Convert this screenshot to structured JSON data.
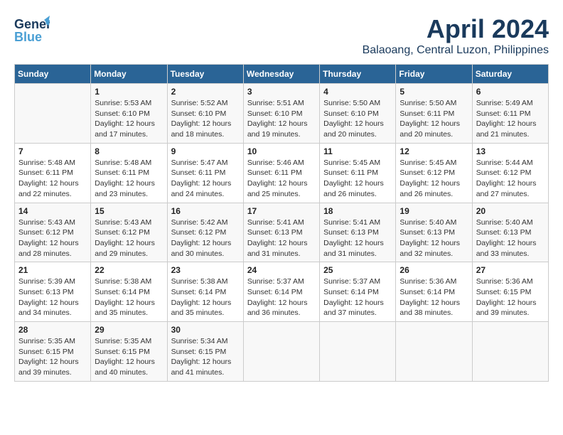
{
  "header": {
    "logo_line1": "General",
    "logo_line2": "Blue",
    "month": "April 2024",
    "location": "Balaoang, Central Luzon, Philippines"
  },
  "weekdays": [
    "Sunday",
    "Monday",
    "Tuesday",
    "Wednesday",
    "Thursday",
    "Friday",
    "Saturday"
  ],
  "weeks": [
    [
      {
        "day": "",
        "info": ""
      },
      {
        "day": "1",
        "info": "Sunrise: 5:53 AM\nSunset: 6:10 PM\nDaylight: 12 hours\nand 17 minutes."
      },
      {
        "day": "2",
        "info": "Sunrise: 5:52 AM\nSunset: 6:10 PM\nDaylight: 12 hours\nand 18 minutes."
      },
      {
        "day": "3",
        "info": "Sunrise: 5:51 AM\nSunset: 6:10 PM\nDaylight: 12 hours\nand 19 minutes."
      },
      {
        "day": "4",
        "info": "Sunrise: 5:50 AM\nSunset: 6:10 PM\nDaylight: 12 hours\nand 20 minutes."
      },
      {
        "day": "5",
        "info": "Sunrise: 5:50 AM\nSunset: 6:11 PM\nDaylight: 12 hours\nand 20 minutes."
      },
      {
        "day": "6",
        "info": "Sunrise: 5:49 AM\nSunset: 6:11 PM\nDaylight: 12 hours\nand 21 minutes."
      }
    ],
    [
      {
        "day": "7",
        "info": "Sunrise: 5:48 AM\nSunset: 6:11 PM\nDaylight: 12 hours\nand 22 minutes."
      },
      {
        "day": "8",
        "info": "Sunrise: 5:48 AM\nSunset: 6:11 PM\nDaylight: 12 hours\nand 23 minutes."
      },
      {
        "day": "9",
        "info": "Sunrise: 5:47 AM\nSunset: 6:11 PM\nDaylight: 12 hours\nand 24 minutes."
      },
      {
        "day": "10",
        "info": "Sunrise: 5:46 AM\nSunset: 6:11 PM\nDaylight: 12 hours\nand 25 minutes."
      },
      {
        "day": "11",
        "info": "Sunrise: 5:45 AM\nSunset: 6:11 PM\nDaylight: 12 hours\nand 26 minutes."
      },
      {
        "day": "12",
        "info": "Sunrise: 5:45 AM\nSunset: 6:12 PM\nDaylight: 12 hours\nand 26 minutes."
      },
      {
        "day": "13",
        "info": "Sunrise: 5:44 AM\nSunset: 6:12 PM\nDaylight: 12 hours\nand 27 minutes."
      }
    ],
    [
      {
        "day": "14",
        "info": "Sunrise: 5:43 AM\nSunset: 6:12 PM\nDaylight: 12 hours\nand 28 minutes."
      },
      {
        "day": "15",
        "info": "Sunrise: 5:43 AM\nSunset: 6:12 PM\nDaylight: 12 hours\nand 29 minutes."
      },
      {
        "day": "16",
        "info": "Sunrise: 5:42 AM\nSunset: 6:12 PM\nDaylight: 12 hours\nand 30 minutes."
      },
      {
        "day": "17",
        "info": "Sunrise: 5:41 AM\nSunset: 6:13 PM\nDaylight: 12 hours\nand 31 minutes."
      },
      {
        "day": "18",
        "info": "Sunrise: 5:41 AM\nSunset: 6:13 PM\nDaylight: 12 hours\nand 31 minutes."
      },
      {
        "day": "19",
        "info": "Sunrise: 5:40 AM\nSunset: 6:13 PM\nDaylight: 12 hours\nand 32 minutes."
      },
      {
        "day": "20",
        "info": "Sunrise: 5:40 AM\nSunset: 6:13 PM\nDaylight: 12 hours\nand 33 minutes."
      }
    ],
    [
      {
        "day": "21",
        "info": "Sunrise: 5:39 AM\nSunset: 6:13 PM\nDaylight: 12 hours\nand 34 minutes."
      },
      {
        "day": "22",
        "info": "Sunrise: 5:38 AM\nSunset: 6:14 PM\nDaylight: 12 hours\nand 35 minutes."
      },
      {
        "day": "23",
        "info": "Sunrise: 5:38 AM\nSunset: 6:14 PM\nDaylight: 12 hours\nand 35 minutes."
      },
      {
        "day": "24",
        "info": "Sunrise: 5:37 AM\nSunset: 6:14 PM\nDaylight: 12 hours\nand 36 minutes."
      },
      {
        "day": "25",
        "info": "Sunrise: 5:37 AM\nSunset: 6:14 PM\nDaylight: 12 hours\nand 37 minutes."
      },
      {
        "day": "26",
        "info": "Sunrise: 5:36 AM\nSunset: 6:14 PM\nDaylight: 12 hours\nand 38 minutes."
      },
      {
        "day": "27",
        "info": "Sunrise: 5:36 AM\nSunset: 6:15 PM\nDaylight: 12 hours\nand 39 minutes."
      }
    ],
    [
      {
        "day": "28",
        "info": "Sunrise: 5:35 AM\nSunset: 6:15 PM\nDaylight: 12 hours\nand 39 minutes."
      },
      {
        "day": "29",
        "info": "Sunrise: 5:35 AM\nSunset: 6:15 PM\nDaylight: 12 hours\nand 40 minutes."
      },
      {
        "day": "30",
        "info": "Sunrise: 5:34 AM\nSunset: 6:15 PM\nDaylight: 12 hours\nand 41 minutes."
      },
      {
        "day": "",
        "info": ""
      },
      {
        "day": "",
        "info": ""
      },
      {
        "day": "",
        "info": ""
      },
      {
        "day": "",
        "info": ""
      }
    ]
  ]
}
